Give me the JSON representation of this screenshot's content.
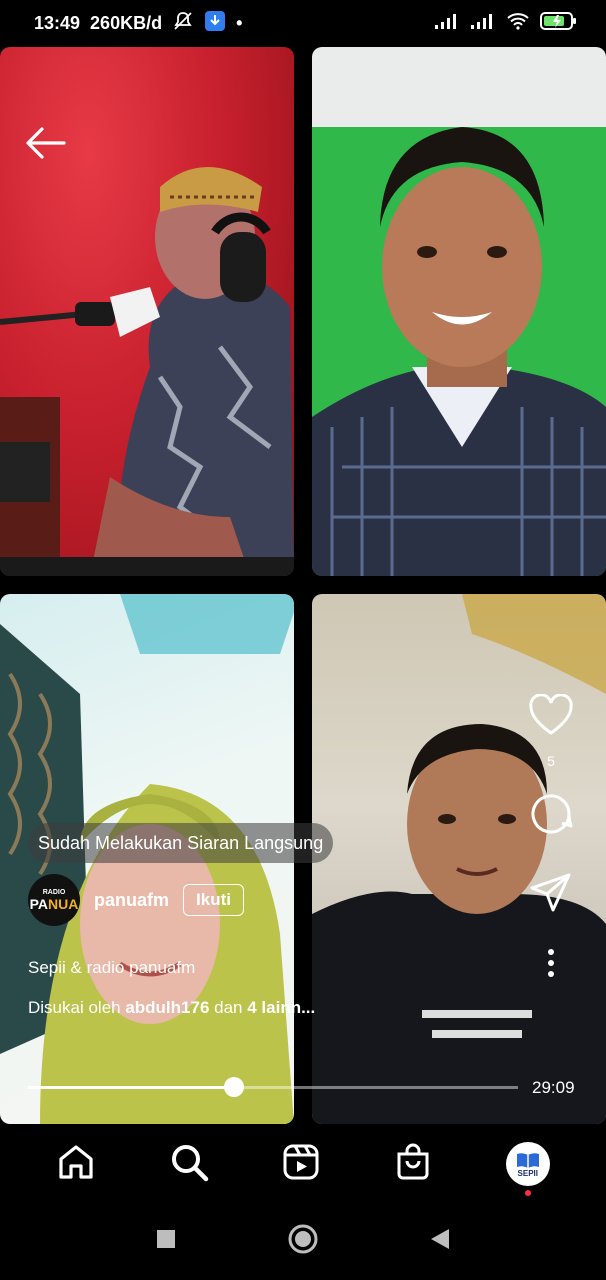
{
  "status_bar": {
    "time": "13:49",
    "data_rate": "260KB/d",
    "dot": "•"
  },
  "video_tiles": [
    {
      "name": "host-radio-studio"
    },
    {
      "name": "guest-green-screen"
    },
    {
      "name": "guest-hijab"
    },
    {
      "name": "guest-living-room"
    }
  ],
  "overlay": {
    "caption": "Sudah Melakukan Siaran Langsung",
    "username": "panuafm",
    "follow_label": "Ikuti",
    "description": "Sepii & radio panuafm",
    "liked_prefix": "Disukai oleh ",
    "liked_user": "abdulh176",
    "liked_mid": " dan ",
    "liked_others": "4 lainn...",
    "like_count": "5",
    "elapsed_time": "29:09",
    "progress_fraction": 0.42
  },
  "avatar_logo": {
    "line1": "RADIO",
    "line2a": "PA",
    "line2b": "NUA"
  },
  "profile_logo": {
    "text": "SEPII"
  },
  "nav": {
    "items": [
      "home-icon",
      "search-icon",
      "reels-icon",
      "shop-icon",
      "profile-avatar"
    ]
  },
  "colors": {
    "background": "#000000",
    "notification_dot": "#ff3040",
    "green_screen": "#31b84a",
    "studio_red": "#c8202e",
    "battery": "#6ee36b"
  }
}
